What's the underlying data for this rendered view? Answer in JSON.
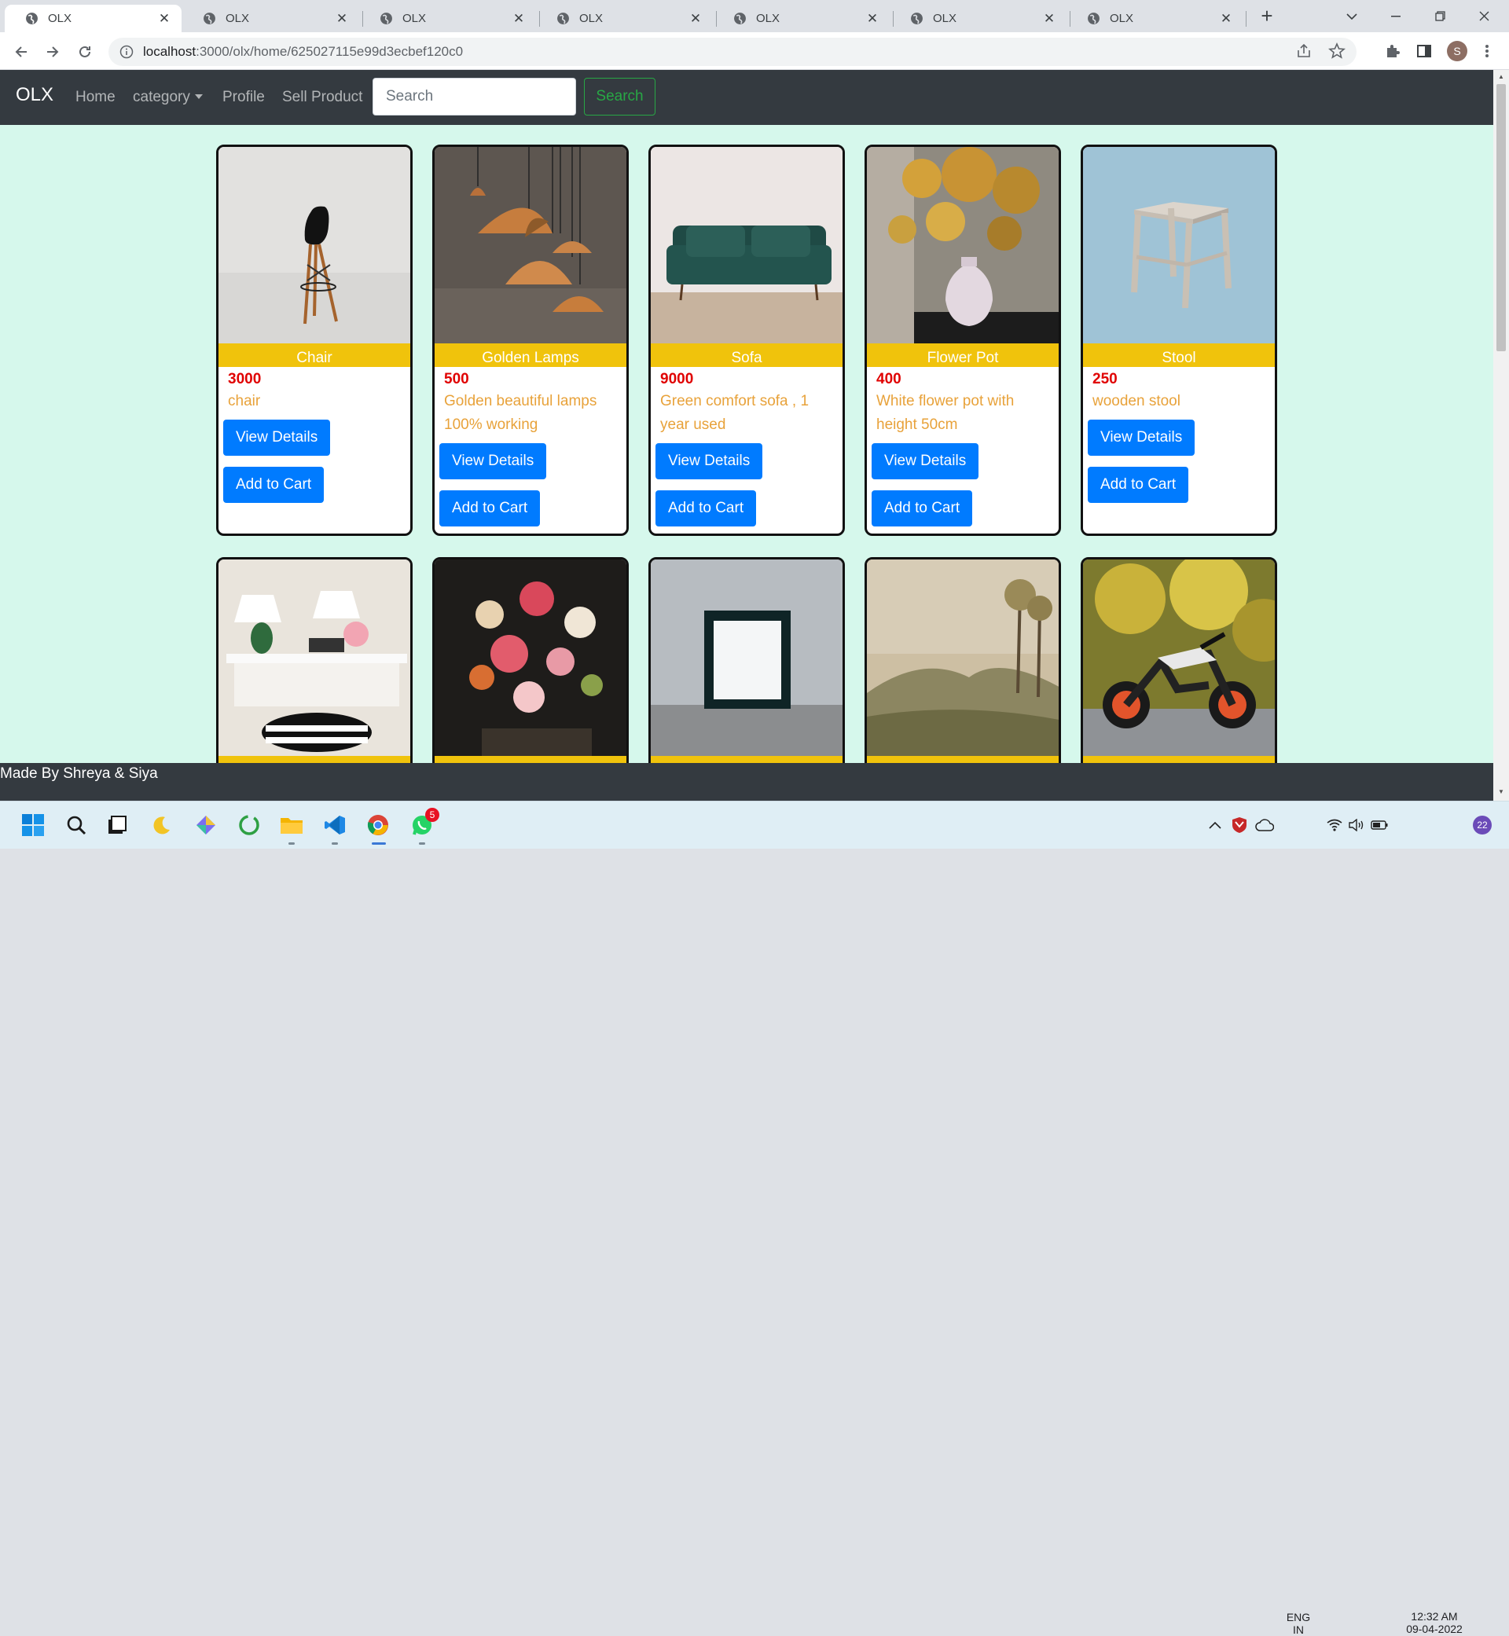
{
  "browser": {
    "tabs": [
      {
        "title": "OLX",
        "active": true
      },
      {
        "title": "OLX"
      },
      {
        "title": "OLX"
      },
      {
        "title": "OLX"
      },
      {
        "title": "OLX"
      },
      {
        "title": "OLX"
      },
      {
        "title": "OLX"
      }
    ],
    "url_host": "localhost",
    "url_rest": ":3000/olx/home/625027115e99d3ecbef120c0",
    "profile_initial": "S"
  },
  "navbar": {
    "brand": "OLX",
    "links": [
      "Home",
      "category",
      "Profile",
      "Sell Product"
    ],
    "search_placeholder": "Search",
    "search_button": "Search"
  },
  "products": [
    {
      "name": "Chair",
      "price": "3000",
      "desc": "chair",
      "view_label": "View Details",
      "cart_label": "Add to Cart"
    },
    {
      "name": "Golden Lamps",
      "price": "500",
      "desc": "Golden beautiful lamps 100% working",
      "view_label": "View Details",
      "cart_label": "Add to Cart"
    },
    {
      "name": "Sofa",
      "price": "9000",
      "desc": "Green comfort sofa , 1 year used",
      "view_label": "View Details",
      "cart_label": "Add to Cart"
    },
    {
      "name": "Flower Pot",
      "price": "400",
      "desc": "White flower pot with height 50cm",
      "view_label": "View Details",
      "cart_label": "Add to Cart"
    },
    {
      "name": "Stool",
      "price": "250",
      "desc": "wooden stool",
      "view_label": "View Details",
      "cart_label": "Add to Cart"
    }
  ],
  "footer": "Made By Shreya & Siya",
  "taskbar": {
    "lang_top": "ENG",
    "lang_bottom": "IN",
    "time": "12:32 AM",
    "date": "09-04-2022",
    "whatsapp_badge": "5",
    "notifications": "22"
  },
  "colors": {
    "navbar": "#343a40",
    "page_bg": "#d6f8ec",
    "name_band": "#f0c30c",
    "price": "#e00000",
    "desc": "#e8a23a",
    "primary": "#007bff",
    "search_green": "#28a745"
  }
}
